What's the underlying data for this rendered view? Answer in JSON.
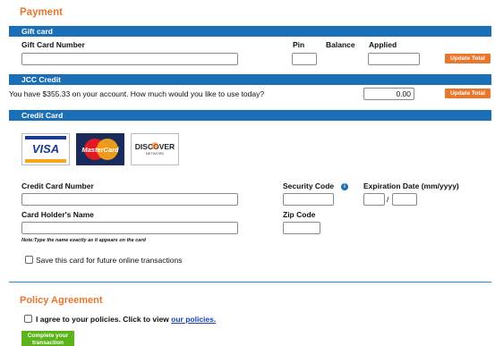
{
  "payment": {
    "title": "Payment"
  },
  "gift_card": {
    "bar_label": "Gift card",
    "number_label": "Gift Card Number",
    "pin_label": "Pin",
    "balance_label": "Balance",
    "applied_label": "Applied",
    "update_label": "Update Total"
  },
  "jcc_credit": {
    "bar_label": "JCC Credit",
    "message": "You have $355.33 on your account. How much would you like to use today?",
    "amount_value": "0.00",
    "update_label": "Update Total"
  },
  "credit_card": {
    "bar_label": "Credit Card",
    "logos": {
      "visa": "VISA",
      "mastercard": "MasterCard",
      "discover": "DISCOVER",
      "discover_sub": "NETWORK"
    },
    "number_label": "Credit Card Number",
    "security_label": "Security Code",
    "expiration_label": "Expiration Date (mm/yyyy)",
    "expiration_sep": "/",
    "holder_label": "Card Holder's Name",
    "zip_label": "Zip Code",
    "note": "Note:Type the name exactly as it appears on the card",
    "save_label": "Save this card for future online transactions",
    "info_icon_glyph": "i"
  },
  "policy": {
    "title": "Policy Agreement",
    "agree_text": "I agree to your policies. Click to view",
    "link_text": "our policies.",
    "complete_button_line1": "Complete your",
    "complete_button_line2": "transaction"
  },
  "colors": {
    "accent_orange": "#e8762c",
    "bar_blue": "#1b6fb6",
    "complete_green": "#5db31a"
  }
}
